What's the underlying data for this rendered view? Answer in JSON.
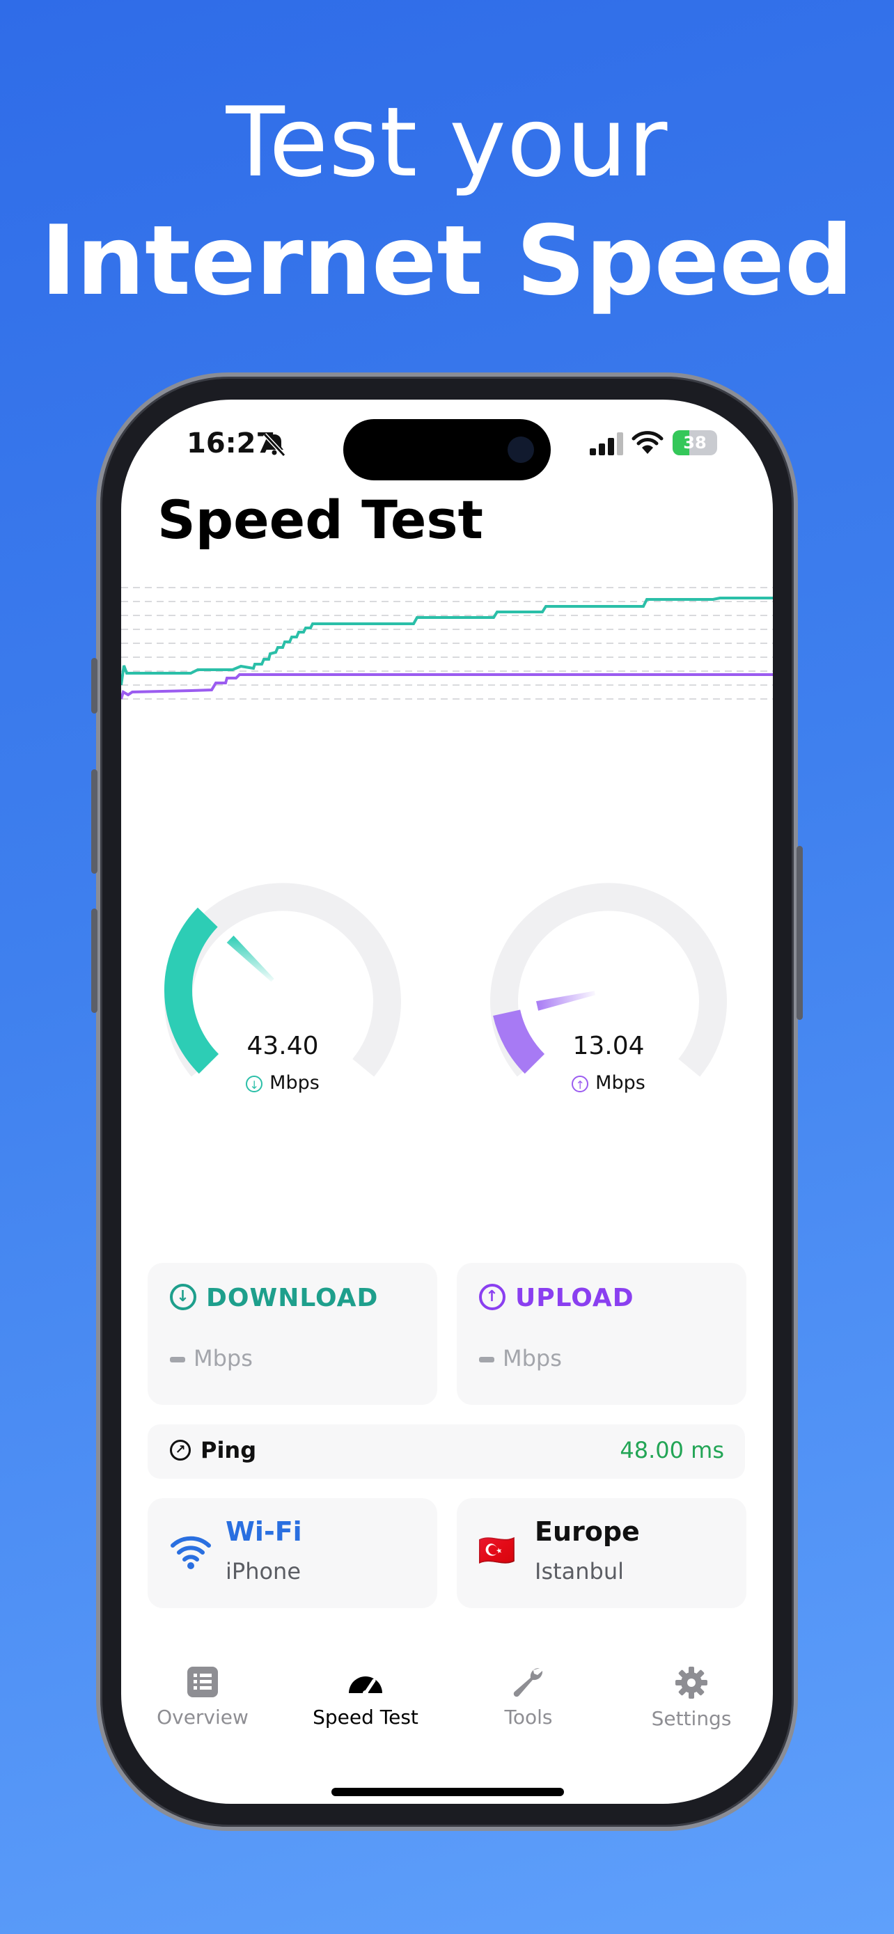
{
  "headline": {
    "line1": "Test your",
    "line2": "Internet Speed"
  },
  "status_bar": {
    "time": "16:27",
    "battery": "38",
    "battery_level": 0.38
  },
  "screen_title": "Speed Test",
  "gauges": {
    "download": {
      "value": "43.40",
      "unit": "Mbps",
      "color": "#2dcdb5",
      "level": 0.33
    },
    "upload": {
      "value": "13.04",
      "unit": "Mbps",
      "color": "#a77af4",
      "level": 0.12
    }
  },
  "cards": {
    "download": {
      "label": "DOWNLOAD",
      "unit": "Mbps",
      "color": "#1e9f8c"
    },
    "upload": {
      "label": "UPLOAD",
      "unit": "Mbps",
      "color": "#8a3ff0"
    }
  },
  "ping": {
    "label": "Ping",
    "value": "48.00 ms"
  },
  "network": {
    "type": "Wi-Fi",
    "device": "iPhone"
  },
  "server": {
    "region": "Europe",
    "city": "Istanbul",
    "flag": "🇹🇷"
  },
  "tabs": [
    {
      "label": "Overview",
      "icon": "list-icon",
      "active": false
    },
    {
      "label": "Speed Test",
      "icon": "speedometer-icon",
      "active": true
    },
    {
      "label": "Tools",
      "icon": "wrench-icon",
      "active": false
    },
    {
      "label": "Settings",
      "icon": "gear-icon",
      "active": false
    }
  ],
  "colors": {
    "download": "#2dbfa6",
    "upload": "#9b5cf0",
    "accent_blue": "#2a6fe0",
    "ping_green": "#23a556"
  }
}
